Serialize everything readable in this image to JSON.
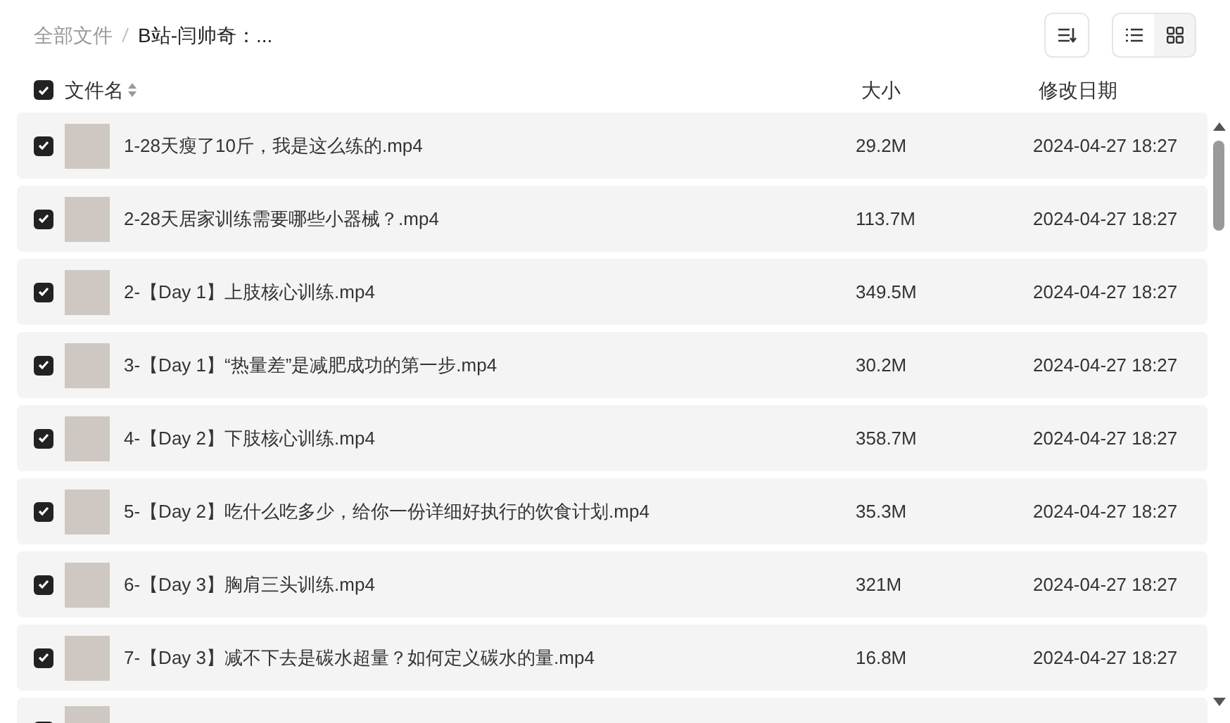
{
  "breadcrumb": [
    {
      "label": "全部文件",
      "current": false
    },
    {
      "label": "B站-闫帅奇：...",
      "current": true
    }
  ],
  "view_modes": [
    {
      "kind": "list",
      "selected": true
    },
    {
      "kind": "grid",
      "selected": false
    }
  ],
  "header": {
    "checked": true,
    "columns": [
      "文件名",
      "大小",
      "修改日期"
    ]
  },
  "rows": [
    {
      "name": "1-28天瘦了10斤，我是这么练的.mp4",
      "size": "29.2M",
      "date": "2024-04-27 18:27",
      "checked": true
    },
    {
      "name": "2-28天居家训练需要哪些小器械？.mp4",
      "size": "113.7M",
      "date": "2024-04-27 18:27",
      "checked": true
    },
    {
      "name": "2-【Day 1】上肢核心训练.mp4",
      "size": "349.5M",
      "date": "2024-04-27 18:27",
      "checked": true
    },
    {
      "name": "3-【Day 1】“热量差”是减肥成功的第一步.mp4",
      "size": "30.2M",
      "date": "2024-04-27 18:27",
      "checked": true
    },
    {
      "name": "4-【Day 2】下肢核心训练.mp4",
      "size": "358.7M",
      "date": "2024-04-27 18:27",
      "checked": true
    },
    {
      "name": "5-【Day 2】吃什么吃多少，给你一份详细好执行的饮食计划.mp4",
      "size": "35.3M",
      "date": "2024-04-27 18:27",
      "checked": true
    },
    {
      "name": "6-【Day 3】胸肩三头训练.mp4",
      "size": "321M",
      "date": "2024-04-27 18:27",
      "checked": true
    },
    {
      "name": "7-【Day 3】减不下去是碳水超量？如何定义碳水的量.mp4",
      "size": "16.8M",
      "date": "2024-04-27 18:27",
      "checked": true
    },
    {
      "checked": true
    }
  ]
}
